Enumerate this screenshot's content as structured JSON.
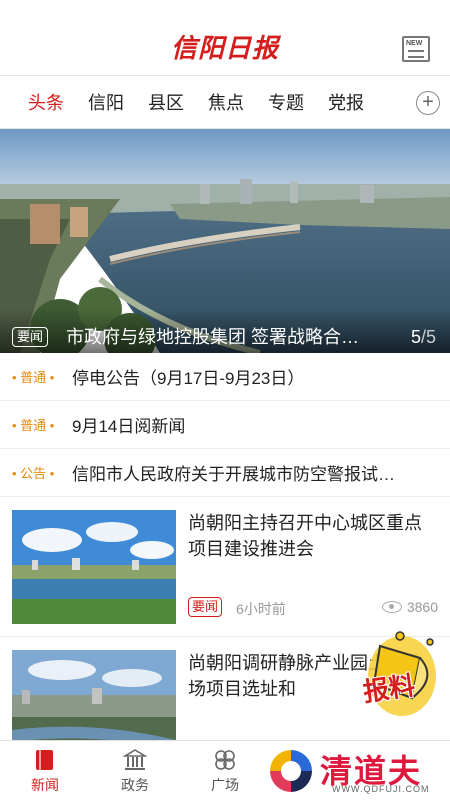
{
  "header": {
    "logo_text": "信阳日报",
    "news_badge": "NEW"
  },
  "tabs": [
    {
      "label": "头条",
      "active": true
    },
    {
      "label": "信阳"
    },
    {
      "label": "县区"
    },
    {
      "label": "焦点"
    },
    {
      "label": "专题"
    },
    {
      "label": "党报"
    }
  ],
  "hero": {
    "tag": "要闻",
    "title": "市政府与绿地控股集团 签署战略合…",
    "page_current": "5",
    "page_total": "/5"
  },
  "text_list": [
    {
      "category": "• 普通 •",
      "title": "停电公告（9月17日-9月23日）"
    },
    {
      "category": "• 普通 •",
      "title": "9月14日阅新闻"
    },
    {
      "category": "• 公告 •",
      "title": "信阳市人民政府关于开展城市防空警报试…"
    }
  ],
  "cards": [
    {
      "title": "尚朝阳主持召开中心城区重点项目建设推进会",
      "tag": "要闻",
      "time": "6小时前",
      "views": "3860"
    },
    {
      "title": "尚朝阳调研静脉产业园土消纳场项目选址和"
    }
  ],
  "bottom_nav": [
    {
      "label": "新闻",
      "icon": "newspaper-icon",
      "active": true
    },
    {
      "label": "政务",
      "icon": "government-building-icon"
    },
    {
      "label": "广场",
      "icon": "clover-icon"
    }
  ],
  "floating": {
    "baoliao_text": "报料"
  },
  "watermark": {
    "text": "清道夫",
    "url": "WWW.QDFUJI.COM"
  },
  "colors": {
    "accent": "#d41e1e",
    "category": "#e8890c",
    "muted": "#999999"
  }
}
